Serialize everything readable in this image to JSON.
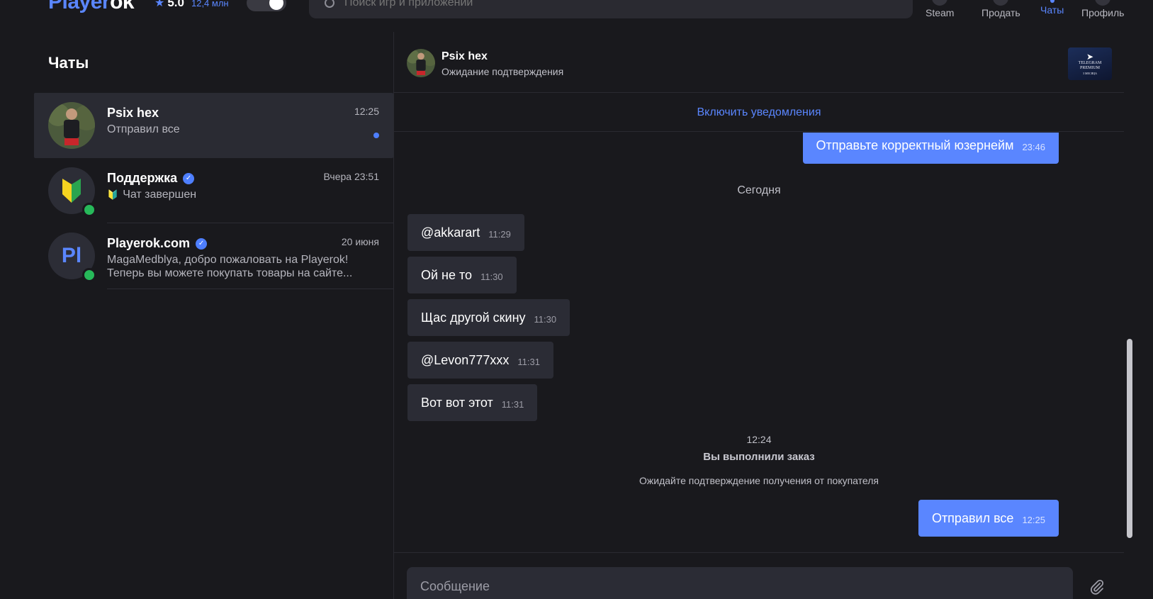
{
  "header": {
    "logo_main": "Player",
    "logo_accent": "ok",
    "rating_score": "5.0",
    "rating_count": "12,4 млн",
    "search_placeholder": "Поиск игр и приложений",
    "nav": [
      {
        "label": "Steam",
        "icon": "steam-icon"
      },
      {
        "label": "Продать",
        "icon": "sell-icon"
      },
      {
        "label": "Чаты",
        "icon": "chats-icon",
        "active": true
      },
      {
        "label": "Профиль",
        "icon": "profile-icon"
      }
    ]
  },
  "sidebar": {
    "title": "Чаты",
    "chats": [
      {
        "name": "Psix hex",
        "time": "12:25",
        "preview": "Отправил все",
        "unread": true,
        "active": true
      },
      {
        "name": "Поддержка",
        "verified": true,
        "time": "Вчера 23:51",
        "preview_icon": "🔰",
        "preview": "Чат завершен",
        "online": true
      },
      {
        "name": "Playerok.com",
        "verified": true,
        "time": "20 июня",
        "avatar_text": "Pl",
        "preview_line1": "MagaMedblya, добро пожаловать на Playerok!",
        "preview_line2": "Теперь вы можете покупать товары на сайте...",
        "online": true
      }
    ]
  },
  "chat": {
    "name": "Psix hex",
    "status": "Ожидание подтверждения",
    "product_label_line1": "TELEGRAM",
    "product_label_line2": "PREMIUM",
    "product_label_line3": "3 МЕСЯЦА",
    "notify_link": "Включить уведомления",
    "date_separator": "Сегодня",
    "messages": [
      {
        "direction": "out",
        "text": "Отправьте корректный юзернейм",
        "time": "23:46"
      },
      {
        "direction": "in",
        "text": "@akkarart",
        "time": "11:29"
      },
      {
        "direction": "in",
        "text": "Ой не то",
        "time": "11:30"
      },
      {
        "direction": "in",
        "text": "Щас другой скину",
        "time": "11:30"
      },
      {
        "direction": "in",
        "text": "@Levon777xxx",
        "time": "11:31"
      },
      {
        "direction": "in",
        "text": "Вот вот этот",
        "time": "11:31"
      },
      {
        "direction": "out",
        "text": "Отправил все",
        "time": "12:25"
      }
    ],
    "system": {
      "time": "12:24",
      "title": "Вы выполнили заказ",
      "text": "Ожидайте подтверждение получения от покупателя"
    },
    "composer_placeholder": "Сообщение"
  },
  "colors": {
    "accent": "#5a86ff",
    "background": "#19191d",
    "panel": "#2b2c35",
    "online": "#27b95a"
  }
}
